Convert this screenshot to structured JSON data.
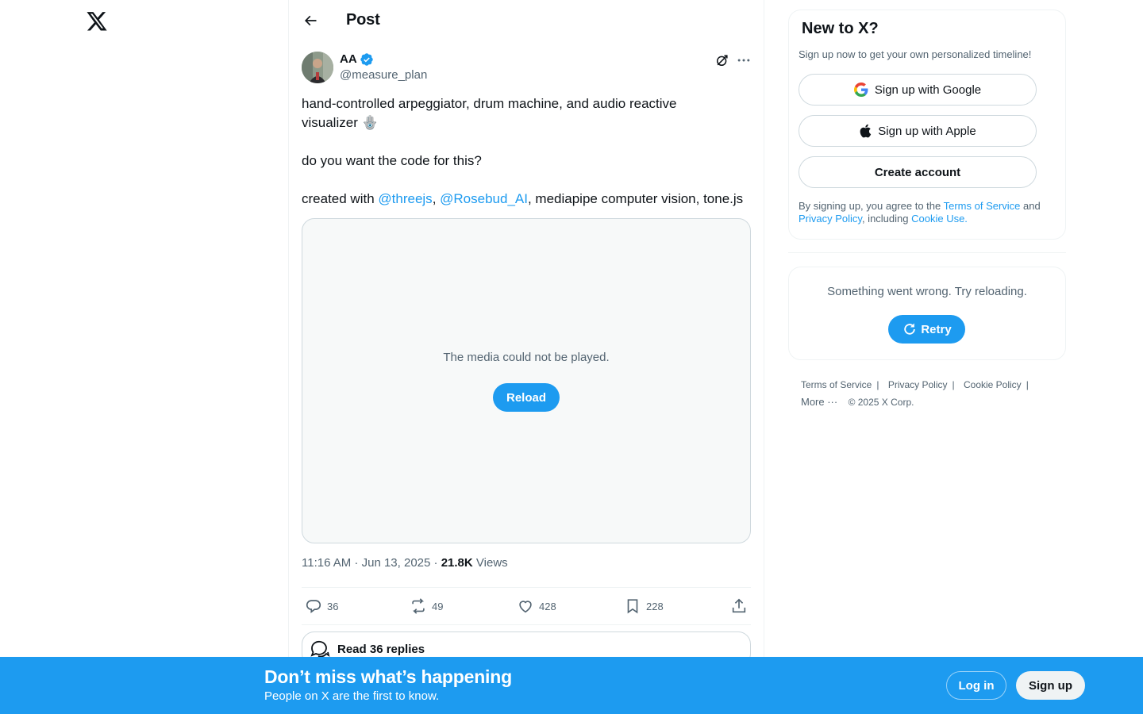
{
  "header": {
    "title": "Post"
  },
  "author": {
    "name": "AA",
    "handle": "@measure_plan"
  },
  "tweet": {
    "line1": "hand-controlled arpeggiator, drum machine, and audio reactive",
    "line2": "visualizer",
    "line2_emoji": "🪬",
    "question": "do you want the code for this?",
    "created_prefix": "created with ",
    "mention1": "@threejs",
    "comma": ", ",
    "mention2": "@Rosebud_AI",
    "created_suffix": ", mediapipe computer vision, tone.js"
  },
  "media": {
    "error_message": "The media could not be played.",
    "reload_label": "Reload"
  },
  "meta": {
    "time": "11:16 AM",
    "dot": " · ",
    "date": "Jun 13, 2025",
    "views_count": "21.8K",
    "views_label": "Views"
  },
  "actions": {
    "replies": "36",
    "reposts": "49",
    "likes": "428",
    "bookmarks": "228"
  },
  "read_replies": {
    "label": "Read 36 replies"
  },
  "signup": {
    "title": "New to X?",
    "subtitle": "Sign up now to get your own personalized timeline!",
    "google_label": "Sign up with Google",
    "apple_label": "Sign up with Apple",
    "create_label": "Create account",
    "terms_prefix": "By signing up, you agree to the ",
    "terms_link": "Terms of Service",
    "terms_and": " and ",
    "privacy_link": "Privacy Policy",
    "including": ", including ",
    "cookie_link": "Cookie Use."
  },
  "error_card": {
    "message": "Something went wrong. Try reloading.",
    "retry_label": "Retry"
  },
  "footer": {
    "terms": "Terms of Service",
    "privacy": "Privacy Policy",
    "cookie": "Cookie Policy",
    "more": "More ···",
    "copyright": "© 2025 X Corp.",
    "separator": "|"
  },
  "banner": {
    "title": "Don’t miss what’s happening",
    "subtitle": "People on X are the first to know.",
    "login_label": "Log in",
    "signup_label": "Sign up"
  },
  "colors": {
    "accent": "#1d9bf0",
    "text": "#0f1419",
    "secondary": "#536471",
    "border": "#cfd9de"
  },
  "icons": [
    "x-logo-icon",
    "back-arrow-icon",
    "verified-badge-icon",
    "grok-icon",
    "more-icon",
    "reply-icon",
    "repost-icon",
    "like-icon",
    "bookmark-icon",
    "share-icon",
    "replies-bubble-icon",
    "google-icon",
    "apple-icon",
    "retry-icon"
  ]
}
